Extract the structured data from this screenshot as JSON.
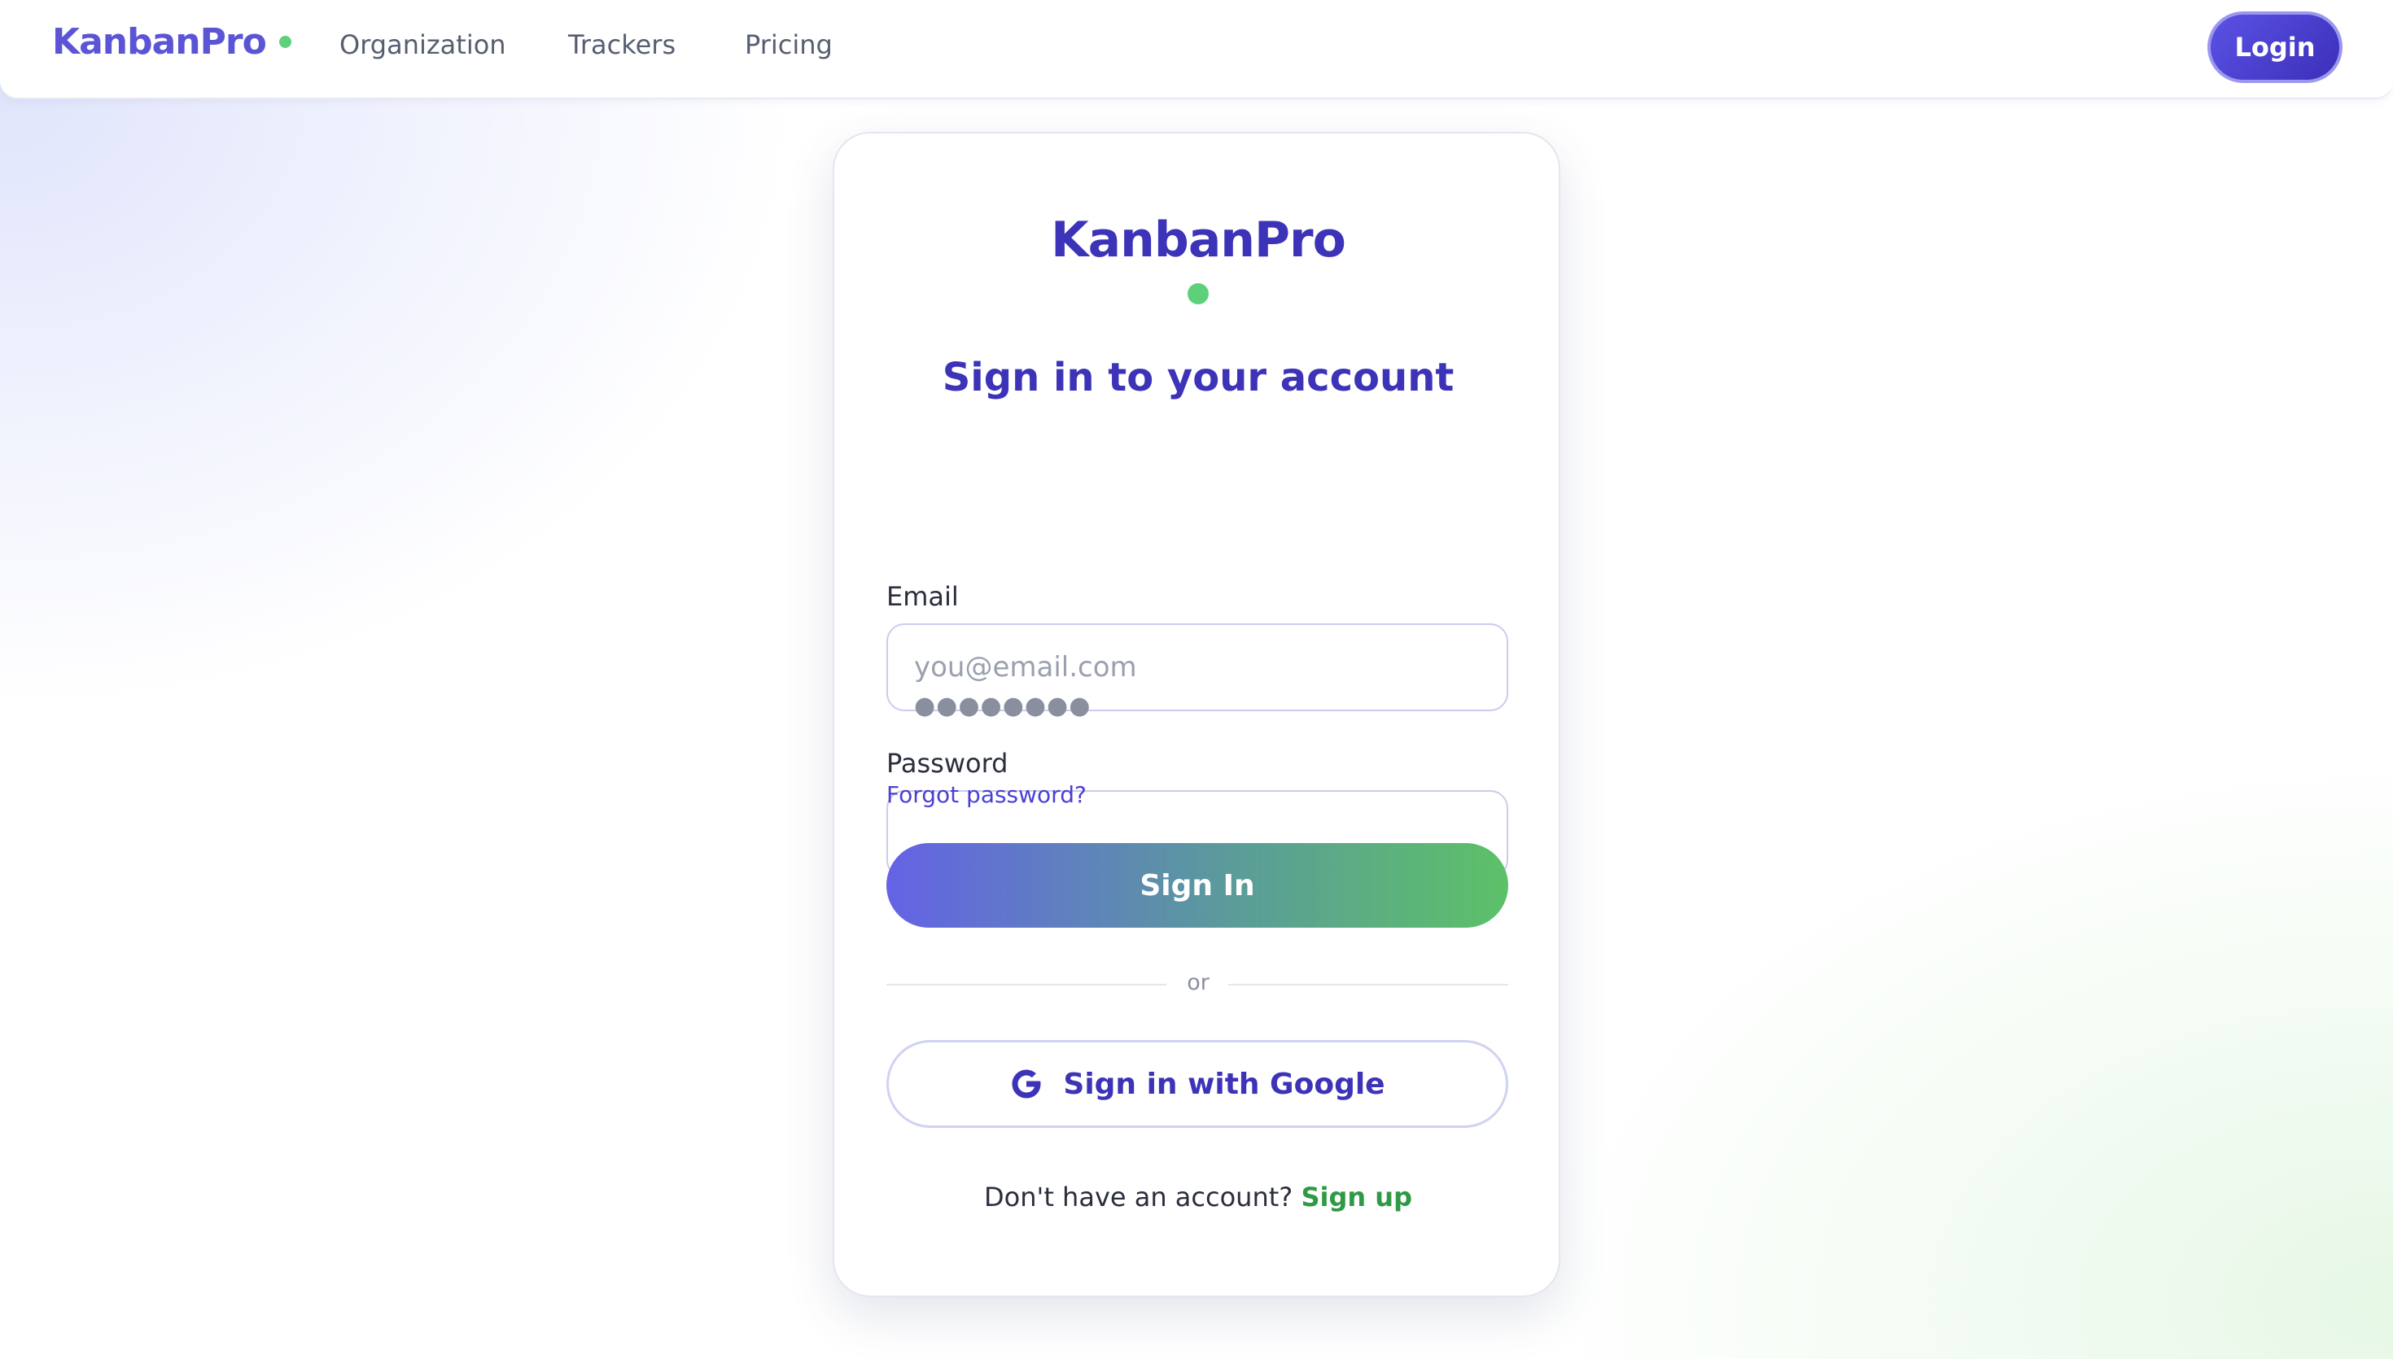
{
  "nav": {
    "brand": "KanbanPro",
    "links": [
      "Organization",
      "Trackers",
      "Pricing"
    ],
    "login_label": "Login"
  },
  "card": {
    "brand": "KanbanPro",
    "title": "Sign in to your account",
    "email_label": "Email",
    "email_placeholder": "you@email.com",
    "password_label": "Password",
    "password_value": "●●●●●●●●",
    "forgot_label": "Forgot password?",
    "signin_label": "Sign In",
    "divider_text": "or",
    "google_label": "Sign in with Google",
    "signup_prompt": "Don't have an account?",
    "signup_link": "Sign up"
  },
  "icons": {
    "brand_dot": "status-dot-icon",
    "google": "google-icon"
  },
  "colors": {
    "brand": "#5b55d6",
    "accent": "#3d33b8",
    "green": "#5fd07a",
    "signup_link": "#2f9a45"
  }
}
